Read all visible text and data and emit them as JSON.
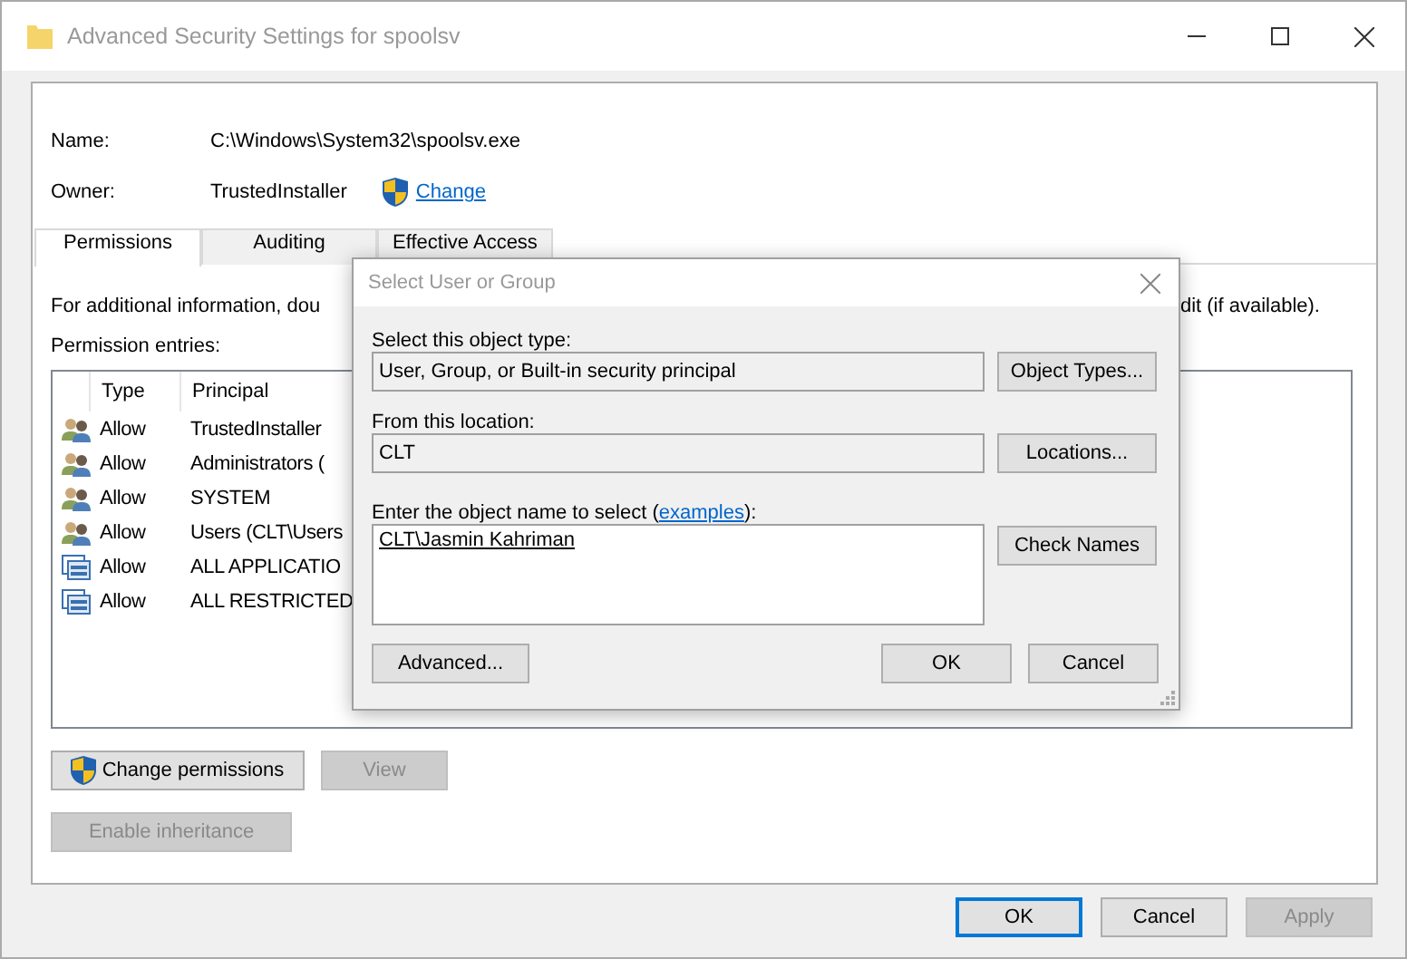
{
  "window": {
    "title": "Advanced Security Settings for spoolsv"
  },
  "details": [
    {
      "label": "Name:",
      "value": "C:\\Windows\\System32\\spoolsv.exe"
    },
    {
      "label": "Owner:",
      "value": "TrustedInstaller",
      "link": "Change"
    }
  ],
  "tabs": [
    {
      "label": "Permissions",
      "selected": true
    },
    {
      "label": "Auditing",
      "selected": false
    },
    {
      "label": "Effective Access",
      "selected": false
    }
  ],
  "info_text": [
    "For additional information, dou",
    "dit (if available)."
  ],
  "entries_label": "Permission entries:",
  "table": {
    "columns": [
      "Type",
      "Principal"
    ],
    "rows": [
      {
        "kind": "user",
        "type": "Allow",
        "principal": "TrustedInstaller"
      },
      {
        "kind": "user",
        "type": "Allow",
        "principal": "Administrators ("
      },
      {
        "kind": "user",
        "type": "Allow",
        "principal": "SYSTEM"
      },
      {
        "kind": "user",
        "type": "Allow",
        "principal": "Users (CLT\\Users"
      },
      {
        "kind": "app",
        "type": "Allow",
        "principal": "ALL APPLICATIO"
      },
      {
        "kind": "app",
        "type": "Allow",
        "principal": "ALL RESTRICTED"
      }
    ]
  },
  "actions": [
    {
      "label": "Change permissions",
      "shield": true,
      "disabled": false
    },
    {
      "label": "View",
      "shield": false,
      "disabled": true
    }
  ],
  "inheritance_button": {
    "label": "Enable inheritance",
    "disabled": true
  },
  "footer_buttons": [
    {
      "label": "OK",
      "default": true,
      "disabled": false
    },
    {
      "label": "Cancel",
      "default": false,
      "disabled": false
    },
    {
      "label": "Apply",
      "default": false,
      "disabled": true
    }
  ],
  "dialog": {
    "title": "Select User or Group",
    "object_type": {
      "label": "Select this object type:",
      "value": "User, Group, or Built-in security principal",
      "button": "Object Types..."
    },
    "location": {
      "label": "From this location:",
      "value": "CLT",
      "button": "Locations..."
    },
    "object_name": {
      "label": "Enter the object name to select (",
      "link": "examples",
      "label_end": "):",
      "value": "CLT\\Jasmin Kahriman",
      "button": "Check Names"
    },
    "buttons": [
      "Advanced...",
      "OK",
      "Cancel"
    ]
  }
}
